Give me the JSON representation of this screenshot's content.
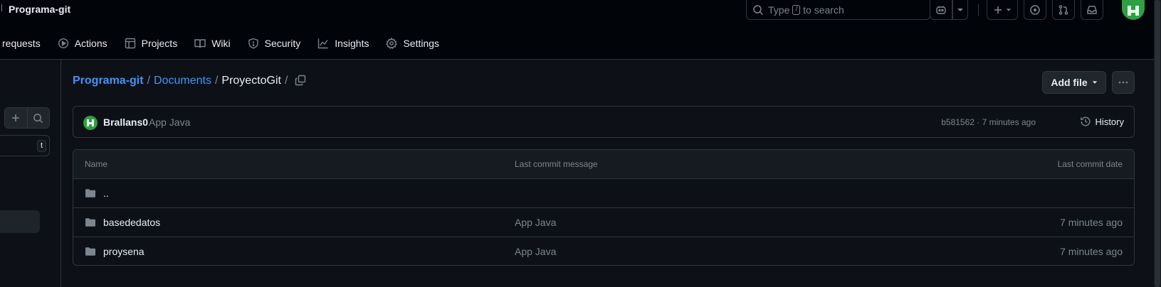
{
  "header": {
    "repo_title": "Programa-git",
    "search": {
      "prefix": "Type",
      "key": "/",
      "suffix": "to search"
    }
  },
  "nav": {
    "items": [
      {
        "label": "l requests",
        "icon": "pull-request-icon"
      },
      {
        "label": "Actions",
        "icon": "play-icon"
      },
      {
        "label": "Projects",
        "icon": "table-icon"
      },
      {
        "label": "Wiki",
        "icon": "book-icon"
      },
      {
        "label": "Security",
        "icon": "shield-icon"
      },
      {
        "label": "Insights",
        "icon": "graph-icon"
      },
      {
        "label": "Settings",
        "icon": "gear-icon"
      }
    ]
  },
  "sidebar": {
    "filter_shortcut": "t"
  },
  "breadcrumb": {
    "root": "Programa-git",
    "sep": "/",
    "middle": "Documents",
    "current": "ProyectoGit",
    "trail_sep": "/"
  },
  "actions": {
    "add_file": "Add file"
  },
  "commit": {
    "author": "Brallans0",
    "message": "App Java",
    "meta": "b581562 · 7 minutes ago",
    "history_label": "History"
  },
  "table": {
    "columns": [
      "Name",
      "Last commit message",
      "Last commit date"
    ],
    "rows": [
      {
        "name": "..",
        "message": "",
        "date": ""
      },
      {
        "name": "basededatos",
        "message": "App Java",
        "date": "7 minutes ago"
      },
      {
        "name": "proysena",
        "message": "App Java",
        "date": "7 minutes ago"
      }
    ]
  },
  "colors": {
    "background": "#0d1117",
    "header_bg": "#010409",
    "link": "#4493f8",
    "border": "#30363d",
    "muted": "#7d8590",
    "avatar": "#2ea043"
  }
}
